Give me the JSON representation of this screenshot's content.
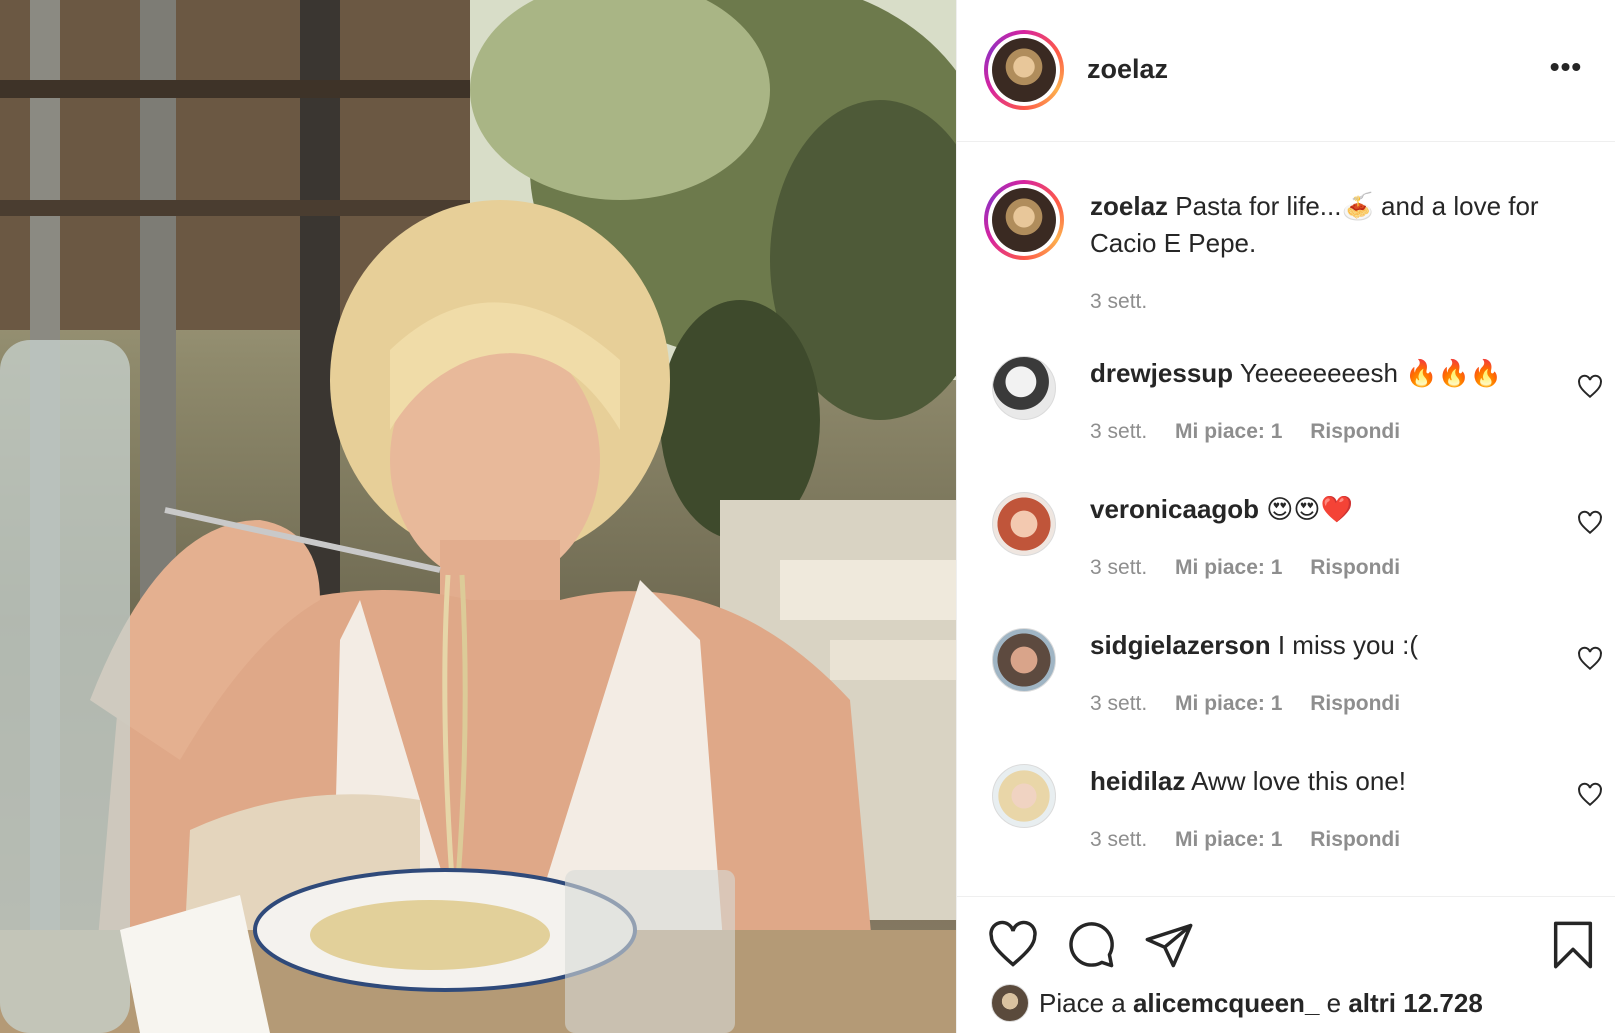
{
  "post": {
    "username": "zoelaz",
    "more_label": "•••",
    "photo_icon": "post-photo-woman-eating-pasta",
    "caption": {
      "username": "zoelaz",
      "text": "Pasta for life...🍝 and a love for Cacio E Pepe.",
      "time": "3 sett."
    }
  },
  "comments": [
    {
      "username": "drewjessup",
      "text": "Yeeeeeeeesh 🔥🔥🔥",
      "time": "3 sett.",
      "likes": "Mi piace: 1",
      "reply": "Rispondi"
    },
    {
      "username": "veronicaagob",
      "text": "😍😍❤️",
      "time": "3 sett.",
      "likes": "Mi piace: 1",
      "reply": "Rispondi"
    },
    {
      "username": "sidgielazerson",
      "text": "I miss you :(",
      "time": "3 sett.",
      "likes": "Mi piace: 1",
      "reply": "Rispondi"
    },
    {
      "username": "heidilaz",
      "text": "Aww love this one!",
      "time": "3 sett.",
      "likes": "Mi piace: 1",
      "reply": "Rispondi"
    }
  ],
  "likes_line": {
    "prefix": "Piace a",
    "user": "alicemcqueen_",
    "middle": "e",
    "others": "altri 12.728"
  },
  "colors": {
    "text": "#262626",
    "muted": "#8e8e8e",
    "border": "#efefef"
  }
}
